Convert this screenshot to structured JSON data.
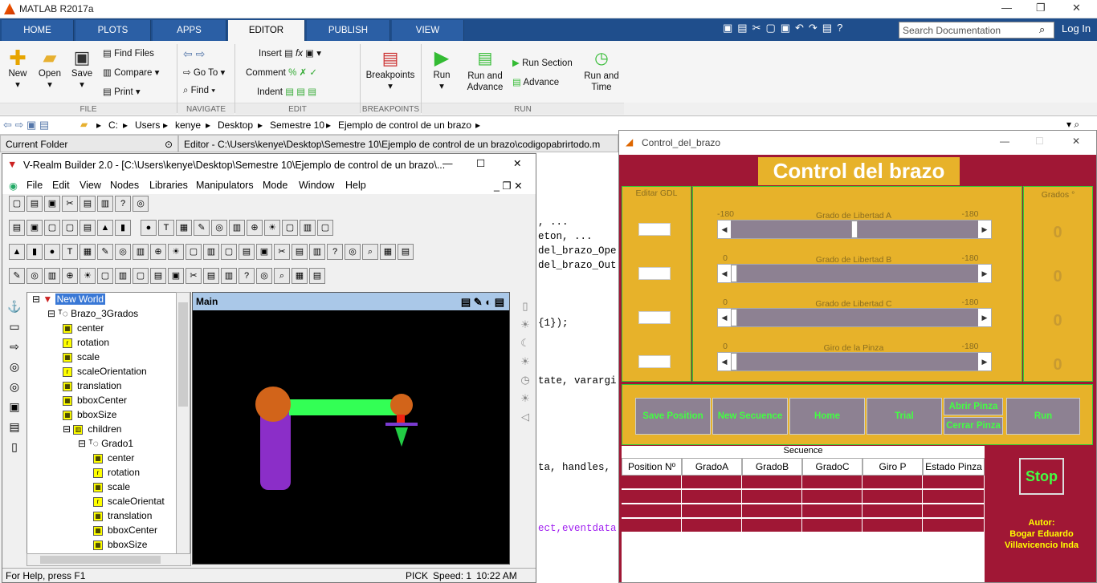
{
  "matlab": {
    "title": "MATLAB R2017a",
    "tabs": [
      "HOME",
      "PLOTS",
      "APPS",
      "EDITOR",
      "PUBLISH",
      "VIEW"
    ],
    "search_placeholder": "Search Documentation",
    "login": "Log In",
    "ribbon": {
      "new": "New",
      "open": "Open",
      "save": "Save",
      "find_files": "Find Files",
      "compare": "Compare",
      "print": "Print",
      "go_to": "Go To",
      "find": "Find",
      "insert": "Insert",
      "comment": "Comment",
      "indent": "Indent",
      "breakpoints": "Breakpoints",
      "run": "Run",
      "run_advance": "Run and Advance",
      "run_section": "Run Section",
      "advance": "Advance",
      "run_time": "Run and Time",
      "sections": [
        "FILE",
        "NAVIGATE",
        "EDIT",
        "BREAKPOINTS",
        "RUN"
      ]
    },
    "path": [
      "C:",
      "Users",
      "kenye",
      "Desktop",
      "Semestre 10",
      "Ejemplo de control de un brazo"
    ],
    "current_folder": "Current Folder",
    "editor_tab": "Editor - C:\\Users\\kenye\\Desktop\\Semestre 10\\Ejemplo de control de un brazo\\codigopabrirtodo.m",
    "code": [
      ", ...",
      "eton, ...",
      "del_brazo_Ope",
      "del_brazo_Out",
      "{1});",
      "tate, varargi",
      "ta, handles,",
      "ect,eventdata"
    ]
  },
  "vrealm": {
    "title": "V-Realm Builder 2.0 - [C:\\Users\\kenye\\Desktop\\Semestre 10\\Ejemplo de control de un brazo\\...",
    "menu": [
      "File",
      "Edit",
      "View",
      "Nodes",
      "Libraries",
      "Manipulators",
      "Mode",
      "Window",
      "Help"
    ],
    "tree": [
      "New World",
      "Brazo_3Grados",
      "center",
      "rotation",
      "scale",
      "scaleOrientation",
      "translation",
      "bboxCenter",
      "bboxSize",
      "children",
      "Grado1",
      "center",
      "rotation",
      "scale",
      "scaleOrientat",
      "translation",
      "bboxCenter",
      "bboxSize"
    ],
    "scene_title": "Main",
    "status": {
      "help": "For Help, press F1",
      "mode": "PICK",
      "speed": "Speed: 1",
      "time": "10:22 AM"
    }
  },
  "control": {
    "window_title": "Control_del_brazo",
    "title": "Control del brazo",
    "edit_gdl": "Editar GDL",
    "grados": "Grados °",
    "sliders": [
      {
        "label": "Grado de Libertad A",
        "min": "-180",
        "max": "-180",
        "value": 0.5,
        "deg": "0"
      },
      {
        "label": "Grado de Libertad B",
        "min": "0",
        "max": "-180",
        "value": 0,
        "deg": "0"
      },
      {
        "label": "Grado de Libertad C",
        "min": "0",
        "max": "-180",
        "value": 0,
        "deg": "0"
      },
      {
        "label": "Giro de la Pinza",
        "min": "0",
        "max": "-180",
        "value": 0,
        "deg": "0"
      }
    ],
    "buttons": {
      "save": "Save Position",
      "new_seq": "New Secuence",
      "home": "Home",
      "trial": "Trial",
      "abrir": "Abrir Pinza",
      "cerrar": "Cerrar Pinza",
      "run": "Run"
    },
    "secuence": "Secuence",
    "columns": [
      "Position Nº",
      "GradoA",
      "GradoB",
      "GradoC",
      "Giro P",
      "Estado Pinza"
    ],
    "stop": "Stop",
    "autor": "Autor:",
    "autor_name1": "Bogar Eduardo",
    "autor_name2": "Villavicencio Inda",
    "colors": {
      "bg": "#a01735",
      "panel": "#e7b22a",
      "btn": "#8d8192",
      "green": "#43ff43"
    }
  }
}
